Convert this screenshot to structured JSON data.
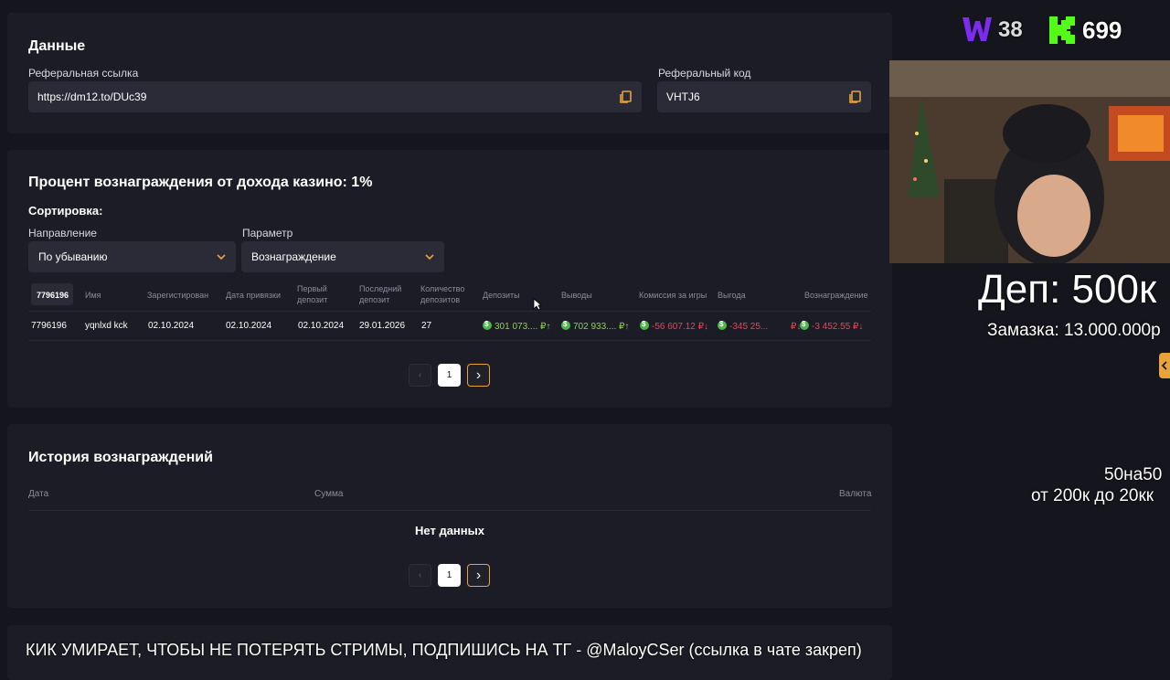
{
  "data_section": {
    "title": "Данные",
    "ref_link_label": "Реферальная ссылка",
    "ref_link_value": "https://dm12.to/DUc39",
    "ref_code_label": "Реферальный код",
    "ref_code_value": "VHTJ6"
  },
  "reward_section": {
    "title": "Процент вознаграждения от дохода казино: 1%",
    "sort_label": "Сортировка:",
    "direction_label": "Направление",
    "direction_value": "По убыванию",
    "param_label": "Параметр",
    "param_value": "Вознаграждение",
    "columns": {
      "id": "7796196",
      "name": "Имя",
      "registered": "Зарегистирован",
      "bind_date": "Дата привязки",
      "first_deposit_1": "Первый",
      "first_deposit_2": "депозит",
      "last_deposit_1": "Последний",
      "last_deposit_2": "депозит",
      "deposit_count_1": "Количество",
      "deposit_count_2": "депозитов",
      "deposits": "Депозиты",
      "withdrawals": "Выводы",
      "commission": "Комиссия за игры",
      "profit": "Выгода",
      "reward": "Вознаграждение"
    },
    "row": {
      "id": "7796196",
      "name": "yqnlxd kck",
      "registered": "02.10.2024",
      "bind_date": "02.10.2024",
      "first_deposit": "02.10.2024",
      "last_deposit": "29.01.2026",
      "deposit_count": "27",
      "deposits": "301 073....",
      "withdrawals": "702 933....",
      "commission": "-56 607.12",
      "profit": "-345 25...",
      "reward": "-3 452.55",
      "currency": "₽",
      "up": "↑",
      "down": "↓"
    },
    "pagination": {
      "prev": "‹",
      "current": "1",
      "next": "›"
    }
  },
  "history_section": {
    "title": "История вознаграждений",
    "col_date": "Дата",
    "col_sum": "Сумма",
    "col_currency": "Валюта",
    "empty": "Нет данных",
    "pagination": {
      "prev": "‹",
      "current": "1",
      "next": "›"
    }
  },
  "stream_overlay": {
    "w_count": "38",
    "k_count": "699",
    "dep": "Деп: 500к",
    "zamazka": "Замазка: 13.000.000р",
    "promo_1": "50на50",
    "promo_2": "от 200к до 20кк",
    "ticker": "КИК УМИРАЕТ, ЧТОБЫ НЕ ПОТЕРЯТЬ СТРИМЫ, ПОДПИШИСЬ НА ТГ - @MaloyCSer (ссылка в чате закреп)"
  },
  "colors": {
    "accent": "#e8a33b",
    "green": "#8fd14f",
    "red": "#e2485a",
    "w_logo": "#7b2cf0",
    "k_logo": "#53fc18"
  }
}
